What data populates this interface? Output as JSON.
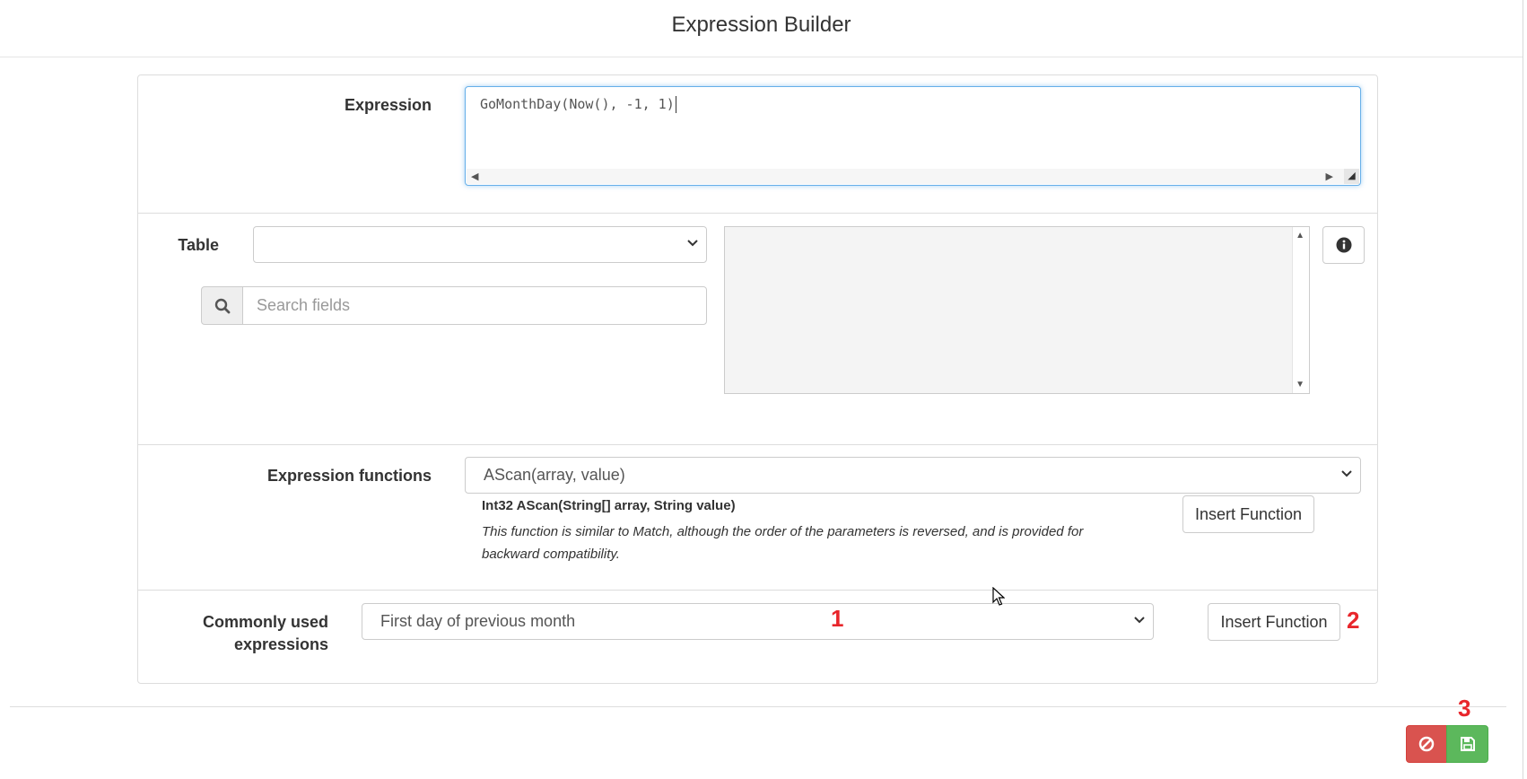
{
  "header": {
    "title": "Expression Builder"
  },
  "expression": {
    "label": "Expression",
    "value": "GoMonthDay(Now(), -1, 1)"
  },
  "table": {
    "label": "Table",
    "selected": ""
  },
  "search": {
    "placeholder": "Search fields"
  },
  "expression_functions": {
    "label": "Expression functions",
    "selected": "AScan(array, value)",
    "signature": "Int32 AScan(String[] array, String value)",
    "description": "This function is similar to Match, although the order of the parameters is reversed, and is provided for backward compatibility.",
    "insert_label": "Insert Function"
  },
  "common": {
    "label_line1": "Commonly used",
    "label_line2": "expressions",
    "selected": "First day of previous month",
    "insert_label": "Insert Function"
  },
  "annotations": {
    "one": "1",
    "two": "2",
    "three": "3"
  },
  "colors": {
    "cancel": "#d9534f",
    "save": "#5cb85c",
    "focus_border": "#66afe9",
    "annotation": "#e8262b"
  },
  "icons": {
    "search": "search-icon",
    "info": "info-icon",
    "cancel": "ban-icon",
    "save": "floppy-disk-icon"
  }
}
